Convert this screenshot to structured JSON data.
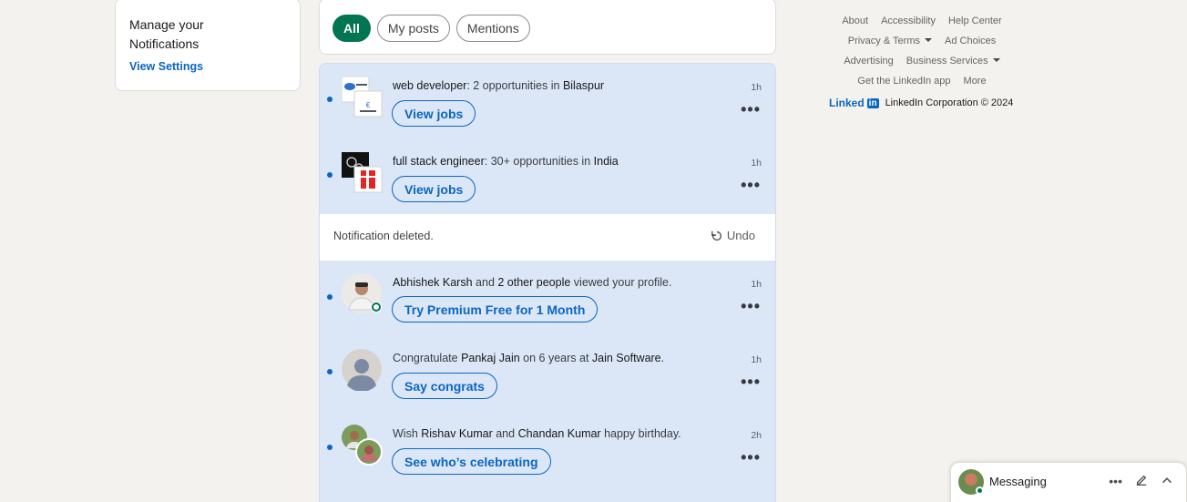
{
  "left_card": {
    "title": "Manage your Notifications",
    "link": "View Settings"
  },
  "filters": [
    "All",
    "My posts",
    "Mentions"
  ],
  "active_filter": "All",
  "notifications": [
    {
      "parts": [
        [
          "web developer",
          true
        ],
        [
          ": 2 opportunities in ",
          false
        ],
        [
          "Bilaspur",
          true
        ]
      ],
      "button": "View jobs",
      "time": "1h",
      "avatar": "company-logo-stack"
    },
    {
      "parts": [
        [
          "full stack engineer",
          true
        ],
        [
          ": 30+ opportunities in ",
          false
        ],
        [
          "India",
          true
        ]
      ],
      "button": "View jobs",
      "time": "1h",
      "avatar": "company-logo-stack"
    },
    {
      "parts": [
        [
          "Abhishek Karsh",
          true
        ],
        [
          " and ",
          false
        ],
        [
          "2 other people",
          true
        ],
        [
          " viewed your profile.",
          false
        ]
      ],
      "button": "Try Premium Free for 1 Month",
      "time": "1h",
      "avatar": "person-photo"
    },
    {
      "parts": [
        [
          "Congratulate ",
          false
        ],
        [
          "Pankaj Jain",
          true
        ],
        [
          " on 6 years at ",
          false
        ],
        [
          "Jain Software",
          true
        ],
        [
          ".",
          false
        ]
      ],
      "button": "Say congrats",
      "time": "1h",
      "avatar": "ghost-avatar"
    },
    {
      "parts": [
        [
          "Wish ",
          false
        ],
        [
          "Rishav Kumar",
          true
        ],
        [
          " and ",
          false
        ],
        [
          "Chandan Kumar",
          true
        ],
        [
          " happy birthday.",
          false
        ]
      ],
      "button": "See who’s celebrating",
      "time": "2h",
      "avatar": "two-person-photos"
    }
  ],
  "deleted": {
    "message": "Notification deleted.",
    "undo": "Undo"
  },
  "footer": {
    "rows": [
      [
        "About",
        "Accessibility",
        "Help Center"
      ],
      [
        "Privacy & Terms",
        "Ad Choices"
      ],
      [
        "Advertising",
        "Business Services"
      ],
      [
        "Get the LinkedIn app",
        "More"
      ]
    ],
    "brand_word": "Linked",
    "brand_in": "in",
    "copyright": "LinkedIn Corporation © 2024"
  },
  "messaging": {
    "label": "Messaging"
  },
  "colors": {
    "accent": "#0a66c2",
    "active_pill": "#01754f",
    "unread_bg": "#dbe7f7",
    "page_bg": "#f4f2ee"
  }
}
